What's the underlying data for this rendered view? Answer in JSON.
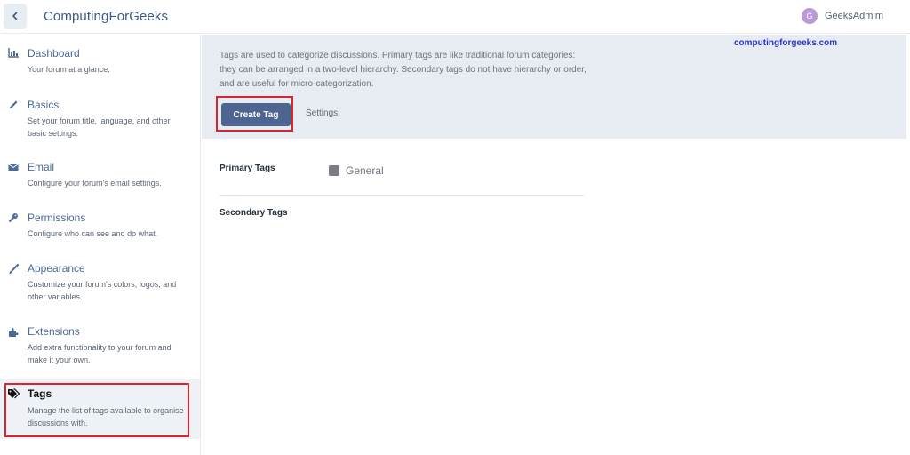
{
  "header": {
    "title": "ComputingForGeeks",
    "user": {
      "initial": "G",
      "name": "GeeksAdmim"
    }
  },
  "sidebar": {
    "items": [
      {
        "icon": "bar-chart-icon",
        "label": "Dashboard",
        "desc": "Your forum at a glance."
      },
      {
        "icon": "pencil-icon",
        "label": "Basics",
        "desc": "Set your forum title, language, and other basic settings."
      },
      {
        "icon": "envelope-icon",
        "label": "Email",
        "desc": "Configure your forum's email settings."
      },
      {
        "icon": "key-icon",
        "label": "Permissions",
        "desc": "Configure who can see and do what."
      },
      {
        "icon": "paintbrush-icon",
        "label": "Appearance",
        "desc": "Customize your forum's colors, logos, and other variables."
      },
      {
        "icon": "puzzle-icon",
        "label": "Extensions",
        "desc": "Add extra functionality to your forum and make it your own."
      },
      {
        "icon": "tags-icon",
        "label": "Tags",
        "desc": "Manage the list of tags available to organise discussions with.",
        "active": true
      }
    ]
  },
  "main": {
    "intro": "Tags are used to categorize discussions. Primary tags are like traditional forum categories: they can be arranged in a two-level hierarchy. Secondary tags do not have hierarchy or order, and are useful for micro-categorization.",
    "watermark": "computingforgeeks.com",
    "create_label": "Create Tag",
    "settings_label": "Settings",
    "primary_label": "Primary Tags",
    "primary_tags": [
      {
        "name": "General",
        "color": "#7a7d82"
      }
    ],
    "secondary_label": "Secondary Tags"
  },
  "colors": {
    "accent": "#4d6590",
    "highlight": "#d9232d",
    "watermark": "#2a37c8"
  }
}
